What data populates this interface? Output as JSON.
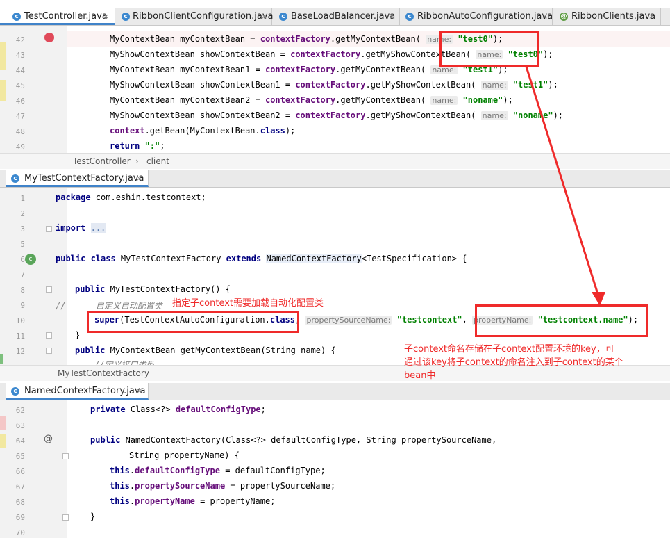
{
  "top_tabs": [
    {
      "label": "TestController.java",
      "icon": "class-icon",
      "active": true
    },
    {
      "label": "RibbonClientConfiguration.java",
      "icon": "class-icon",
      "active": false
    },
    {
      "label": "BaseLoadBalancer.java",
      "icon": "class-icon",
      "active": false
    },
    {
      "label": "RibbonAutoConfiguration.java",
      "icon": "class-icon",
      "active": false
    },
    {
      "label": "RibbonClients.java",
      "icon": "annotation-icon",
      "active": false
    }
  ],
  "tab_close": "×",
  "icon_letter_class": "c",
  "icon_letter_anno": "@",
  "panel1": {
    "lines": [
      {
        "n": "42"
      },
      {
        "n": "43"
      },
      {
        "n": "44"
      },
      {
        "n": "45"
      },
      {
        "n": "46"
      },
      {
        "n": "47"
      },
      {
        "n": "48"
      },
      {
        "n": "49"
      }
    ],
    "breadcrumb": [
      "TestController",
      "client"
    ]
  },
  "panel2": {
    "tab": "MyTestContextFactory.java",
    "lines": [
      {
        "n": "1"
      },
      {
        "n": "2"
      },
      {
        "n": "3"
      },
      {
        "n": "5"
      },
      {
        "n": "6"
      },
      {
        "n": "7"
      },
      {
        "n": "8"
      },
      {
        "n": "9"
      },
      {
        "n": "10"
      },
      {
        "n": "11"
      },
      {
        "n": "12"
      }
    ],
    "breadcrumb": "MyTestContextFactory"
  },
  "panel3": {
    "tab": "NamedContextFactory.java",
    "lines": [
      {
        "n": "62"
      },
      {
        "n": "63"
      },
      {
        "n": "64"
      },
      {
        "n": "65"
      },
      {
        "n": "66"
      },
      {
        "n": "67"
      },
      {
        "n": "68"
      },
      {
        "n": "69"
      },
      {
        "n": "70"
      }
    ]
  },
  "annotations": {
    "note1": "指定子context需要加载自动化配置类",
    "note2_line1": "子context命名存储在子context配置环境的key，可",
    "note2_line2": "通过该key将子context的命名注入到子context的某个",
    "note2_line3": "bean中"
  },
  "colors": {
    "accent": "#4083c9",
    "annotation_red": "#ef2a2a",
    "keyword": "#000080",
    "string": "#008000",
    "field": "#660e7a"
  }
}
